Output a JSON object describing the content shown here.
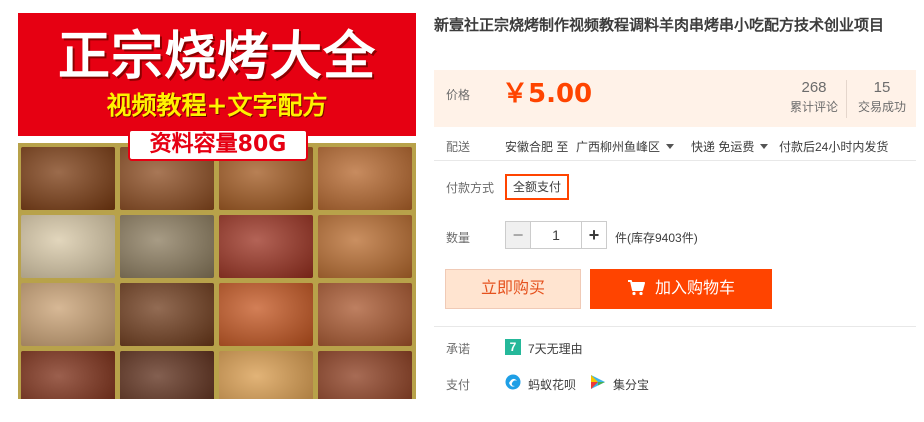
{
  "product": {
    "banner_title": "正宗烧烤大全",
    "banner_subtitle": "视频教程+文字配方",
    "banner_badge": "资料容量80G",
    "title": "新壹社正宗烧烤制作视频教程调料羊肉串烤串小吃配方技术创业项目"
  },
  "price": {
    "label": "价格",
    "value": "￥5.00",
    "reviews_count": "268",
    "reviews_label": "累计评论",
    "sales_count": "15",
    "sales_label": "交易成功"
  },
  "delivery": {
    "label": "配送",
    "from": "安徽合肥 至",
    "to": "广西柳州鱼峰区",
    "shipping": "快递 免运费",
    "dispatch": "付款后24小时内发货"
  },
  "payment_method": {
    "label": "付款方式",
    "option": "全额支付"
  },
  "quantity": {
    "label": "数量",
    "minus": "−",
    "value": "1",
    "plus": "+",
    "stock": "件(库存9403件)"
  },
  "actions": {
    "buy_now": "立即购买",
    "add_to_cart": "加入购物车"
  },
  "promise": {
    "label": "承诺",
    "icon_text": "7",
    "text": "7天无理由"
  },
  "pay": {
    "label": "支付",
    "option1": "蚂蚁花呗",
    "option2": "集分宝"
  },
  "colors": {
    "accent": "#ff4400",
    "banner_red": "#e60012",
    "price_bg": "#fff2e8"
  }
}
